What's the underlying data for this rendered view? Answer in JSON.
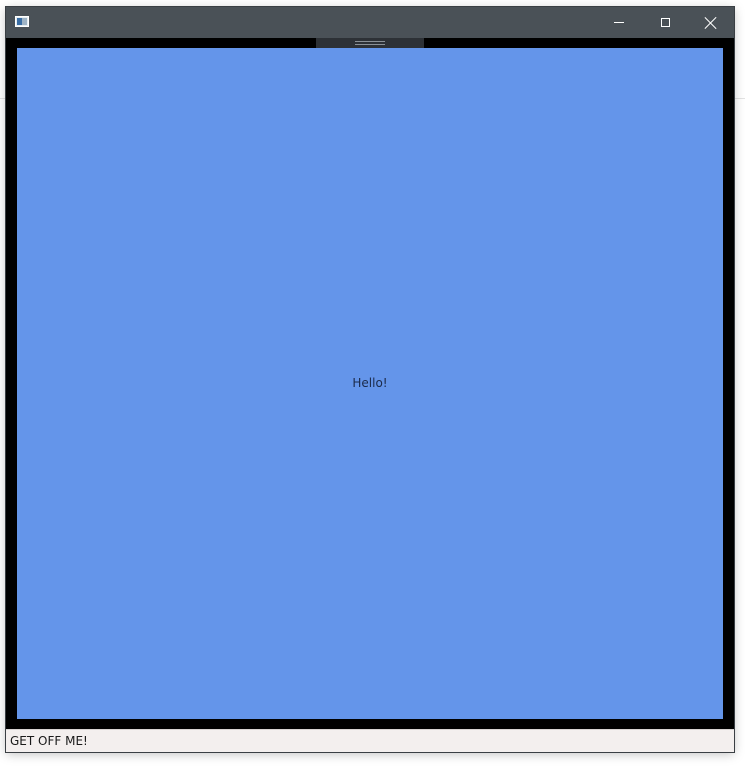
{
  "window": {
    "title": "",
    "icon": "app-window-icon",
    "controls": {
      "minimize_icon": "minimize-icon",
      "maximize_icon": "maximize-icon",
      "close_icon": "close-icon"
    }
  },
  "content": {
    "greeting": "Hello!",
    "background_color": "#6495ea"
  },
  "statusbar": {
    "text": "GET OFF ME!"
  },
  "colors": {
    "titlebar": "#4a5157",
    "frame": "#000000",
    "statusbar": "#f3efee"
  }
}
